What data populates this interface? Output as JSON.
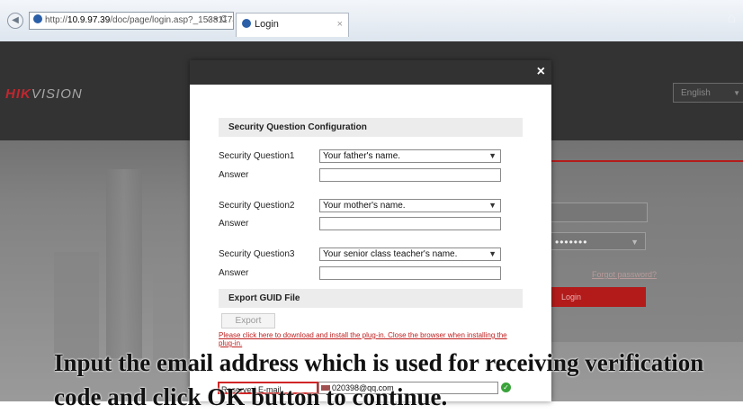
{
  "browser": {
    "url_prefix": "http://",
    "url_host": "10.9.97.39",
    "url_path": "/doc/page/login.asp?_153811747",
    "addr_tools": "⌕ ▾ C",
    "tab_title": "Login",
    "tab_close": "×"
  },
  "page": {
    "logo_brand": "HIK",
    "logo_rest": "VISION",
    "language": "English",
    "password_mask": "•••••••",
    "forgot_password": "Forgot password?",
    "login_button": "Login"
  },
  "modal": {
    "close": "×",
    "security_section_title": "Security Question Configuration",
    "questions": [
      {
        "label": "Security Question1",
        "selected": "Your father's name.",
        "answer_label": "Answer",
        "answer_value": ""
      },
      {
        "label": "Security Question2",
        "selected": "Your mother's name.",
        "answer_label": "Answer",
        "answer_value": ""
      },
      {
        "label": "Security Question3",
        "selected": "Your senior class teacher's name.",
        "answer_label": "Answer",
        "answer_value": ""
      }
    ],
    "export_section_title": "Export GUID File",
    "export_button": "Export",
    "plugin_note": "Please click here to download and install the plug-in. Close the browser when installing the plug-in.",
    "email_label": "Reserved E-mail",
    "email_value": "020398@qq.com"
  },
  "caption": "Input the email address which is used for receiving verification code and click OK button to continue."
}
